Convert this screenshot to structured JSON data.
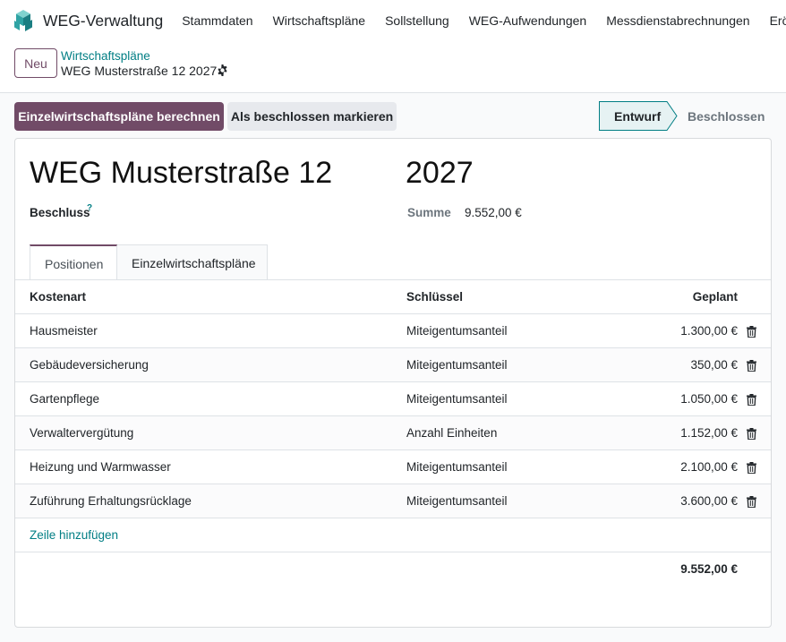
{
  "app": {
    "name": "WEG-Verwaltung",
    "logo_icon": "weg-cubes-logo"
  },
  "menu": [
    "Stammdaten",
    "Wirtschaftspläne",
    "Sollstellung",
    "WEG-Aufwendungen",
    "Messdienstabrechnungen",
    "Eröffn"
  ],
  "control": {
    "new_button": "Neu",
    "breadcrumb": "Wirtschaftspläne",
    "record_title": "WEG Musterstraße 12 2027",
    "gear_icon": "gear-icon"
  },
  "actions": {
    "primary": "Einzelwirtschaftspläne berechnen",
    "secondary": "Als beschlossen markieren"
  },
  "status": {
    "active": "Entwurf",
    "inactive": "Beschlossen"
  },
  "form": {
    "name": "WEG Musterstraße 12",
    "year": "2027",
    "beschluss_label": "Beschluss",
    "help_mark": "?",
    "summe_label": "Summe",
    "summe_value": "9.552,00 €"
  },
  "tabs": [
    "Positionen",
    "Einzelwirtschaftspläne"
  ],
  "table": {
    "headers": {
      "kostenart": "Kostenart",
      "schluessel": "Schlüssel",
      "geplant": "Geplant"
    },
    "rows": [
      {
        "kostenart": "Hausmeister",
        "schluessel": "Miteigentumsanteil",
        "geplant": "1.300,00 €"
      },
      {
        "kostenart": "Gebäudeversicherung",
        "schluessel": "Miteigentumsanteil",
        "geplant": "350,00 €"
      },
      {
        "kostenart": "Gartenpflege",
        "schluessel": "Miteigentumsanteil",
        "geplant": "1.050,00 €"
      },
      {
        "kostenart": "Verwaltervergütung",
        "schluessel": "Anzahl Einheiten",
        "geplant": "1.152,00 €"
      },
      {
        "kostenart": "Heizung und Warmwasser",
        "schluessel": "Miteigentumsanteil",
        "geplant": "2.100,00 €"
      },
      {
        "kostenart": "Zuführung Erhaltungsrücklage",
        "schluessel": "Miteigentumsanteil",
        "geplant": "3.600,00 €"
      }
    ],
    "add_line": "Zeile hinzufügen",
    "total": "9.552,00 €"
  },
  "colors": {
    "primary": "#714b67",
    "link": "#017e84",
    "border": "#dee2e6",
    "logo": "#2fa3a4"
  }
}
